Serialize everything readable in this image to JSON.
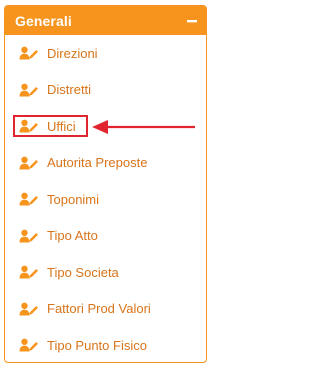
{
  "panel": {
    "title": "Generali",
    "collapse_icon": "minus-icon",
    "accent_color": "#f7941d",
    "link_color": "#d8741a",
    "highlight_color": "#e02430"
  },
  "menu": {
    "items": [
      {
        "label": "Direzioni",
        "icon": "user-edit-icon"
      },
      {
        "label": "Distretti",
        "icon": "user-edit-icon"
      },
      {
        "label": "Uffici",
        "icon": "user-edit-icon",
        "highlighted": true
      },
      {
        "label": "Autorita Preposte",
        "icon": "user-edit-icon"
      },
      {
        "label": "Toponimi",
        "icon": "user-edit-icon"
      },
      {
        "label": "Tipo Atto",
        "icon": "user-edit-icon"
      },
      {
        "label": "Tipo Societa",
        "icon": "user-edit-icon"
      },
      {
        "label": "Fattori Prod Valori",
        "icon": "user-edit-icon"
      },
      {
        "label": "Tipo Punto Fisico",
        "icon": "user-edit-icon"
      }
    ]
  },
  "annotation": {
    "arrow_icon": "left-arrow-icon",
    "target": "Uffici"
  }
}
